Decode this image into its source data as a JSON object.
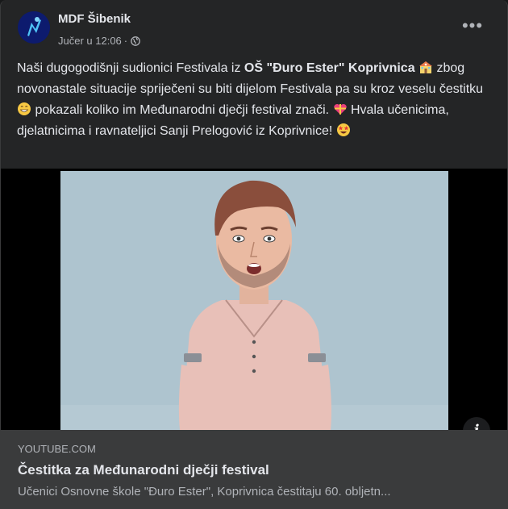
{
  "post": {
    "author": "MDF Šibenik",
    "time": "Jučer u 12:06",
    "separator": "·",
    "more_label": "•••",
    "message": {
      "part1": "Naši dugogodišnji sudionici Festivala iz ",
      "bold": "OŠ \"Đuro Ester\" Koprivnica",
      "part2": " zbog novonastale situacije spriječeni su biti dijelom Festivala pa su kroz veselu čestitku ",
      "part3": " pokazali koliko im Međunarodni dječji festival znači. ",
      "part4": " Hvala učenicima, djelatnicima i ravnateljici Sanji Prelogović iz Koprivnice! "
    },
    "emojis": [
      "school-emoji",
      "grin-emoji",
      "gift-heart-emoji",
      "star-struck-emoji"
    ]
  },
  "link_preview": {
    "domain": "YOUTUBE.COM",
    "title": "Čestitka za Međunarodni dječji festival",
    "description": "Učenici Osnovne škole \"Đuro Ester\", Koprivnica čestitaju 60. obljetn...",
    "info_label": "i"
  },
  "colors": {
    "background": "#18191a",
    "card": "#242526",
    "link_card": "#3a3b3c",
    "primary_text": "#e4e6eb",
    "secondary_text": "#b0b3b8"
  }
}
